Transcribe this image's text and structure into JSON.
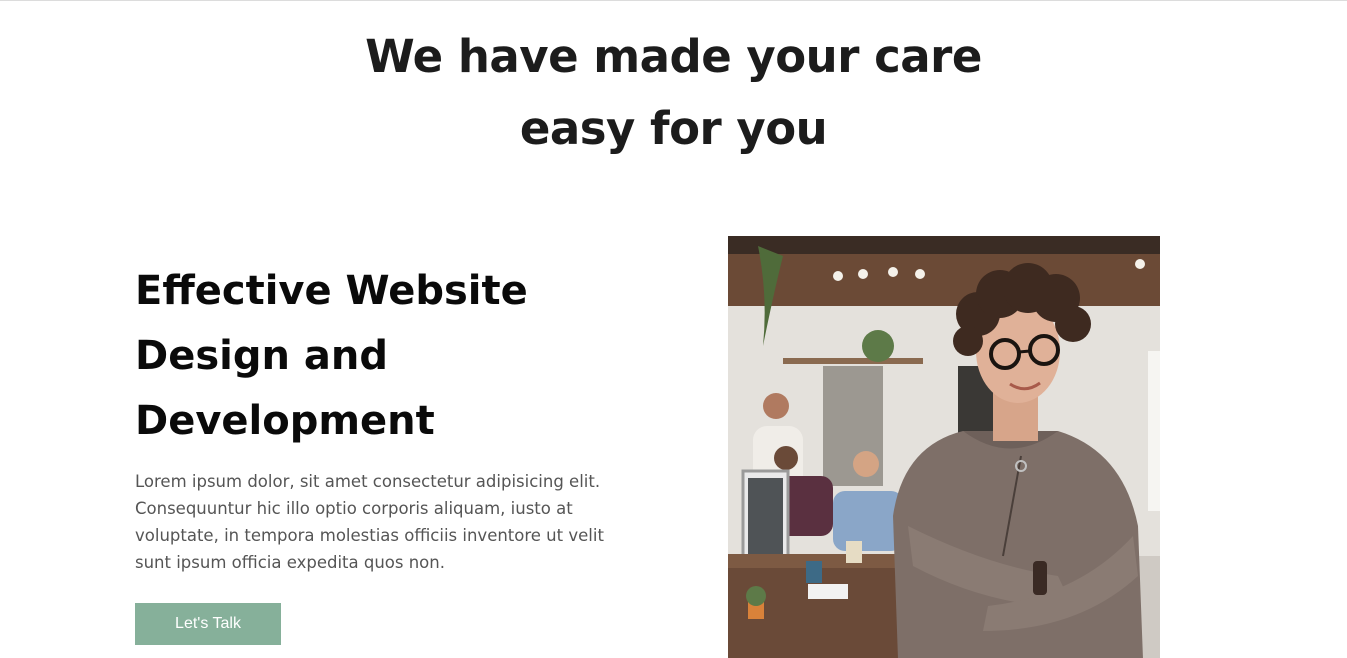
{
  "hero": {
    "title_line1": "We have made your care",
    "title_line2": "easy for you"
  },
  "feature": {
    "title_line1": "Effective Website",
    "title_line2": "Design and",
    "title_line3": "Development",
    "description": "Lorem ipsum dolor, sit amet consectetur adipisicing elit. Consequuntur hic illo optio corporis aliquam, iusto at voluptate, in tempora molestias officiis inventore ut velit sunt ipsum officia expedita quos non.",
    "button_label": "Let's Talk"
  },
  "colors": {
    "accent": "#86b09a",
    "heading": "#1c1c1c",
    "body_text": "#555555"
  }
}
